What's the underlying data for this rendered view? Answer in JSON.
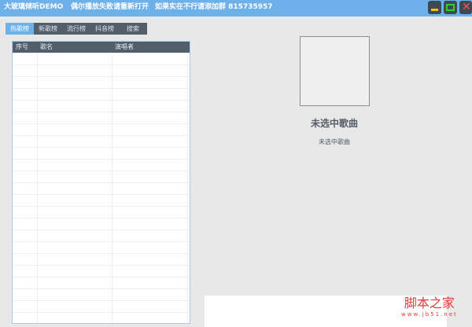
{
  "titlebar": {
    "app_name": "大玻璃倾听DEMO",
    "notice": "偶尔播放失败请重新打开",
    "group": "如果实在不行请添加群 815735957"
  },
  "window_controls": {
    "minimize": "minimize-icon",
    "maximize": "maximize-icon",
    "close": "close-icon"
  },
  "tabs": [
    {
      "label": "热歌榜",
      "active": true
    },
    {
      "label": "新歌榜"
    },
    {
      "label": "流行榜"
    },
    {
      "label": "抖音榜"
    },
    {
      "label": "搜索"
    }
  ],
  "table": {
    "columns": [
      "序号",
      "歌名",
      "演唱者"
    ],
    "rows": []
  },
  "now_playing": {
    "title": "未选中歌曲",
    "artist": "未选中歌曲"
  },
  "watermark": {
    "name": "脚本之家",
    "url": "www.jb51.net"
  },
  "colors": {
    "accent": "#6db0ea",
    "header": "#525e6a"
  }
}
